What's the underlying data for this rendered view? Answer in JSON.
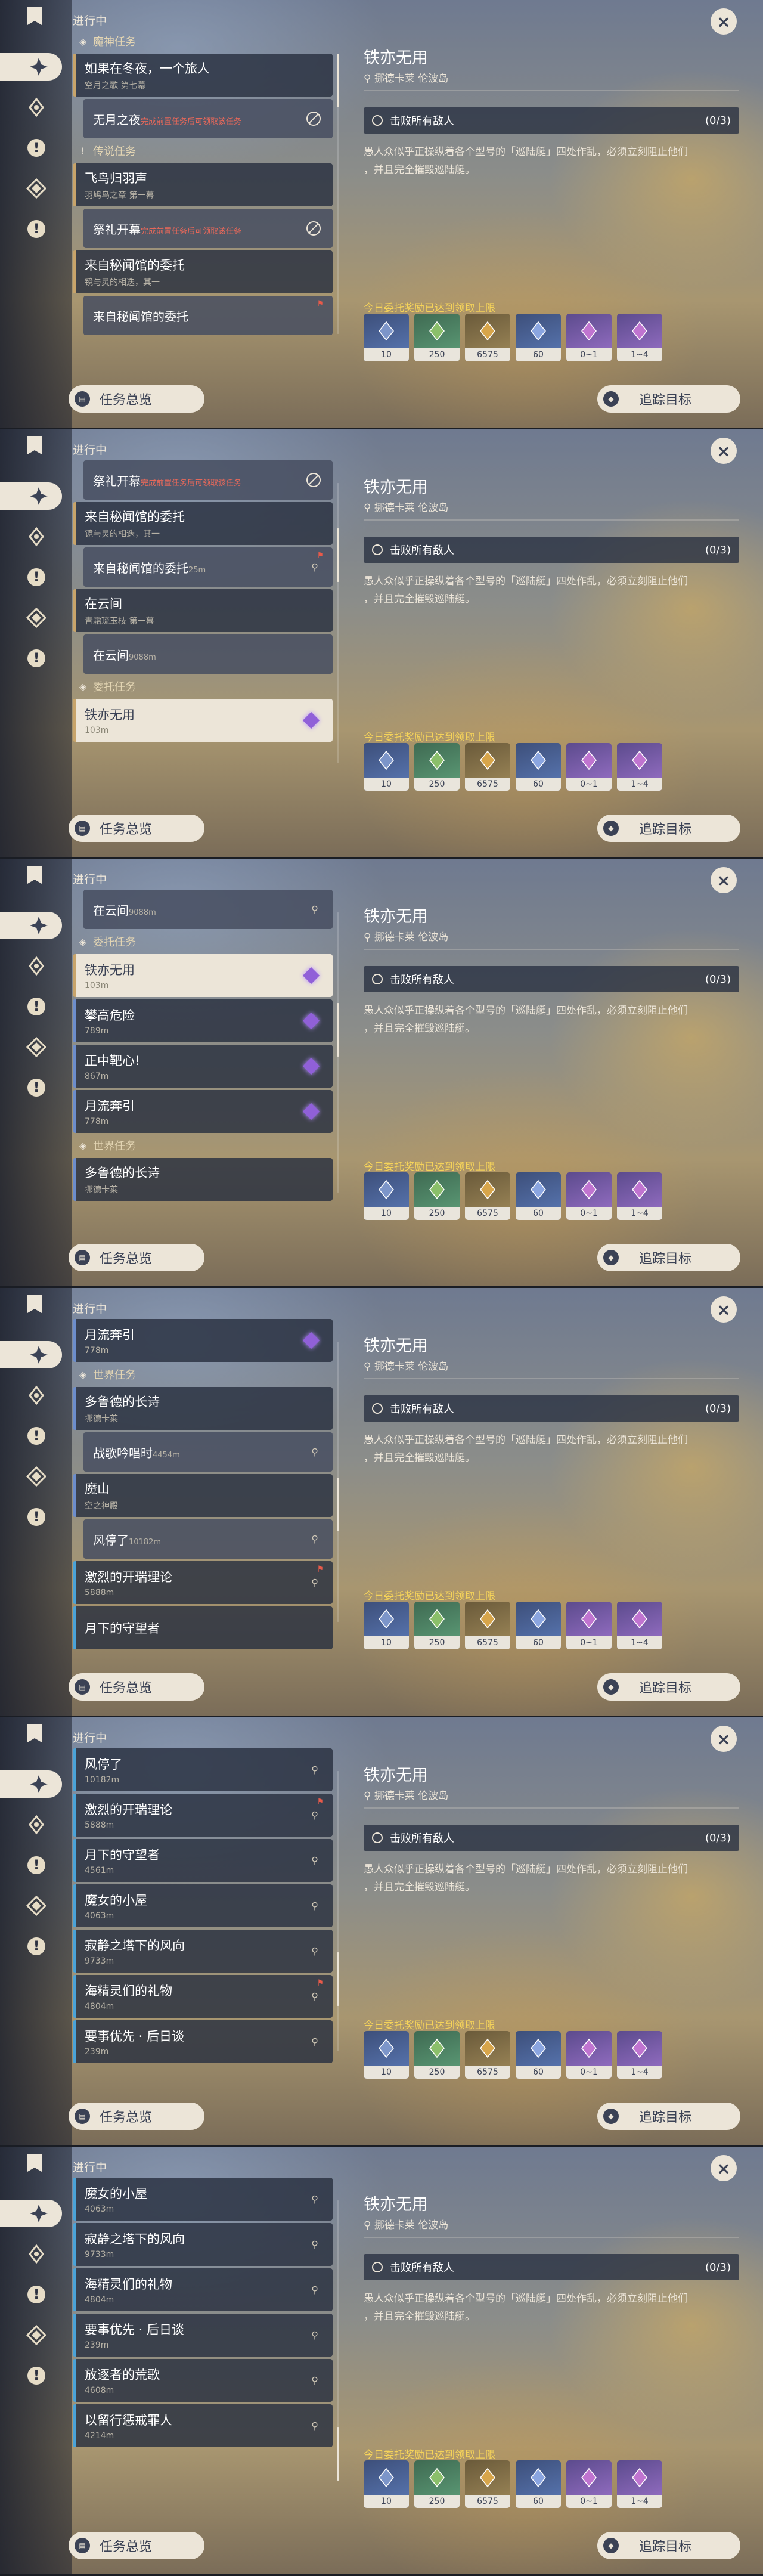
{
  "common": {
    "in_progress": "进行中",
    "overview_label": "任务总览",
    "track_label": "追踪目标",
    "close_glyph": "×",
    "detail": {
      "title": "铁亦无用",
      "location": "挪德卡莱 伦波岛",
      "objective": "击败所有敌人",
      "objective_count": "(0/3)",
      "description_line1": "愚人众似乎正操纵着各个型号的「巡陆艇」四处作乱，必须立刻阻止他们",
      "description_line2": "，并且完全摧毁巡陆艇。",
      "reward_note": "今日委托奖励已达到领取上限",
      "rewards": [
        {
          "name": "primogem-like",
          "count": "10",
          "color": "#7c95c9"
        },
        {
          "name": "adventure-exp",
          "count": "250",
          "color": "#8abf6a"
        },
        {
          "name": "mora",
          "count": "6575",
          "color": "#d7a54a"
        },
        {
          "name": "companionship-exp",
          "count": "60",
          "color": "#8aa5e0"
        },
        {
          "name": "crystal-a",
          "count": "0~1",
          "color": "#c074d0"
        },
        {
          "name": "crystal-b",
          "count": "1~4",
          "color": "#c074d0"
        }
      ]
    }
  },
  "panels": [
    {
      "rows": [
        {
          "kind": "sect",
          "icon": "archon",
          "label": "魔神任务"
        },
        {
          "kind": "q",
          "style": "archon",
          "name": "如果在冬夜，一个旅人",
          "sub": "空月之歌 第七幕"
        },
        {
          "kind": "sub",
          "name": "无月之夜",
          "sub": "完成前置任务后可领取该任务",
          "red": true,
          "icon": "blocked"
        },
        {
          "kind": "sect",
          "icon": "legend",
          "label": "传说任务"
        },
        {
          "kind": "q",
          "style": "archon",
          "name": "飞鸟归羽声",
          "sub": "羽鸠鸟之章 第一幕"
        },
        {
          "kind": "sub",
          "name": "祭礼开幕",
          "sub": "完成前置任务后可领取该任务",
          "red": true,
          "icon": "blocked"
        },
        {
          "kind": "q",
          "style": "archon",
          "name": "来自秘闻馆的委托",
          "sub": "镜与灵的相迭，其一"
        },
        {
          "kind": "sub",
          "name": "来自秘闻馆的委托",
          "sub": "",
          "icon": "none",
          "flag": true
        }
      ]
    },
    {
      "rows": [
        {
          "kind": "sub",
          "name": "祭礼开幕",
          "sub": "完成前置任务后可领取该任务",
          "red": true,
          "icon": "blocked"
        },
        {
          "kind": "q",
          "style": "archon",
          "name": "来自秘闻馆的委托",
          "sub": "镜与灵的相迭，其一"
        },
        {
          "kind": "sub",
          "name": "来自秘闻馆的委托",
          "sub": "25m",
          "icon": "pin",
          "flag": true
        },
        {
          "kind": "q",
          "style": "archon",
          "name": "在云间",
          "sub": "青霜琉玉枝 第一幕"
        },
        {
          "kind": "sub",
          "name": "在云间",
          "sub": "9088m",
          "icon": "none"
        },
        {
          "kind": "sect",
          "icon": "daily",
          "label": "委托任务"
        },
        {
          "kind": "q",
          "style": "sel",
          "name": "铁亦无用",
          "sub": "103m",
          "icon": "purple"
        }
      ]
    },
    {
      "rows": [
        {
          "kind": "sub",
          "name": "在云间",
          "sub": "9088m",
          "icon": "pin"
        },
        {
          "kind": "sect",
          "icon": "daily",
          "label": "委托任务"
        },
        {
          "kind": "q",
          "style": "sel",
          "name": "铁亦无用",
          "sub": "103m",
          "icon": "purple"
        },
        {
          "kind": "q",
          "style": "daily",
          "name": "攀高危险",
          "sub": "789m",
          "icon": "purple"
        },
        {
          "kind": "q",
          "style": "daily",
          "name": "正中靶心!",
          "sub": "867m",
          "icon": "purple"
        },
        {
          "kind": "q",
          "style": "daily",
          "name": "月流奔引",
          "sub": "778m",
          "icon": "purple"
        },
        {
          "kind": "sect",
          "icon": "world",
          "label": "世界任务"
        },
        {
          "kind": "q",
          "style": "world",
          "name": "多鲁德的长诗",
          "sub": "挪德卡莱"
        }
      ]
    },
    {
      "rows": [
        {
          "kind": "q",
          "style": "daily",
          "name": "月流奔引",
          "sub": "778m",
          "icon": "purple"
        },
        {
          "kind": "sect",
          "icon": "world",
          "label": "世界任务"
        },
        {
          "kind": "q",
          "style": "world",
          "name": "多鲁德的长诗",
          "sub": "挪德卡莱"
        },
        {
          "kind": "sub",
          "name": "战歌吟唱时",
          "sub": "4454m",
          "icon": "pin"
        },
        {
          "kind": "q",
          "style": "world",
          "name": "魔山",
          "sub": "空之神殿"
        },
        {
          "kind": "sub",
          "name": "风停了",
          "sub": "10182m",
          "icon": "pin"
        },
        {
          "kind": "q",
          "style": "hang",
          "name": "激烈的开瑞理论",
          "sub": "5888m",
          "icon": "pin",
          "flag": true
        },
        {
          "kind": "q",
          "style": "hang",
          "name": "月下的守望者",
          "sub": "",
          "icon": "none"
        }
      ]
    },
    {
      "rows": [
        {
          "kind": "q",
          "style": "hang",
          "name": "风停了",
          "sub": "10182m",
          "icon": "pin"
        },
        {
          "kind": "q",
          "style": "hang",
          "name": "激烈的开瑞理论",
          "sub": "5888m",
          "icon": "pin",
          "flag": true
        },
        {
          "kind": "q",
          "style": "hang",
          "name": "月下的守望者",
          "sub": "4561m",
          "icon": "pin"
        },
        {
          "kind": "q",
          "style": "hang",
          "name": "魔女的小屋",
          "sub": "4063m",
          "icon": "pin"
        },
        {
          "kind": "q",
          "style": "hang",
          "name": "寂静之塔下的风向",
          "sub": "9733m",
          "icon": "pin"
        },
        {
          "kind": "q",
          "style": "hang",
          "name": "海精灵们的礼物",
          "sub": "4804m",
          "icon": "pin",
          "flag": true
        },
        {
          "kind": "q",
          "style": "hang",
          "name": "要事优先 · 后日谈",
          "sub": "239m",
          "icon": "pin"
        }
      ]
    },
    {
      "rows": [
        {
          "kind": "q",
          "style": "hang",
          "name": "魔女的小屋",
          "sub": "4063m",
          "icon": "pin"
        },
        {
          "kind": "q",
          "style": "hang",
          "name": "寂静之塔下的风向",
          "sub": "9733m",
          "icon": "pin"
        },
        {
          "kind": "q",
          "style": "hang",
          "name": "海精灵们的礼物",
          "sub": "4804m",
          "icon": "pin"
        },
        {
          "kind": "q",
          "style": "hang",
          "name": "要事优先 · 后日谈",
          "sub": "239m",
          "icon": "pin"
        },
        {
          "kind": "q",
          "style": "hang",
          "name": "放逐者的荒歌",
          "sub": "4608m",
          "icon": "pin"
        },
        {
          "kind": "q",
          "style": "hang",
          "name": "以留行惩戒罪人",
          "sub": "4214m",
          "icon": "pin"
        }
      ]
    }
  ]
}
